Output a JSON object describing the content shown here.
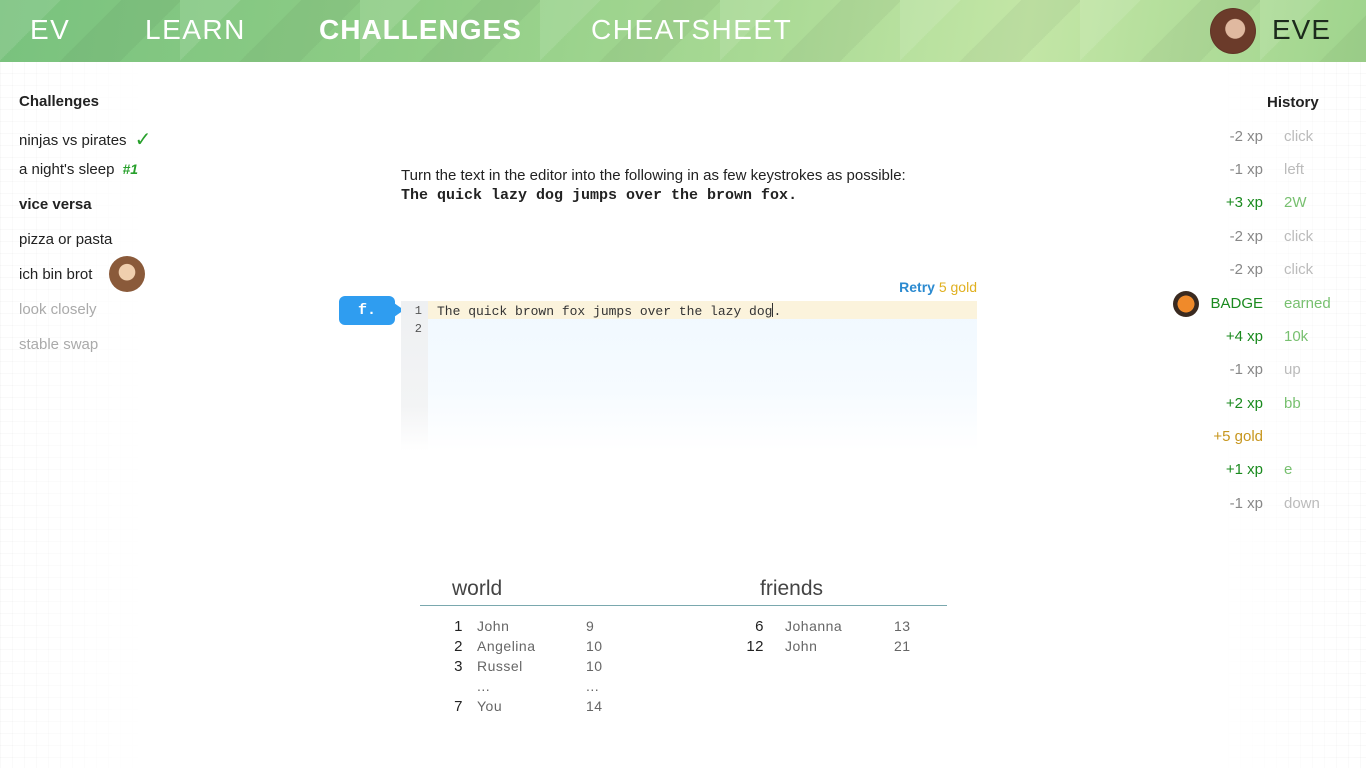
{
  "nav": {
    "logo": "EV",
    "learn": "LEARN",
    "challenges": "CHALLENGES",
    "cheatsheet": "CHEATSHEET",
    "user_name": "EVE"
  },
  "sidebar": {
    "title": "Challenges",
    "items": [
      {
        "label": "ninjas vs pirates",
        "status": "completed"
      },
      {
        "label": "a night's sleep",
        "tag": "#1"
      },
      {
        "label": "vice versa",
        "status": "current"
      },
      {
        "label": "pizza or pasta"
      },
      {
        "label": "ich bin brot",
        "status": "friend"
      },
      {
        "label": "look closely",
        "status": "locked"
      },
      {
        "label": "stable swap",
        "status": "locked"
      }
    ]
  },
  "task": {
    "instruction": "Turn the text in the editor into the following in as few keystrokes as possible:",
    "target": "The quick lazy dog jumps over the brown fox."
  },
  "editor": {
    "retry_label": "Retry",
    "retry_cost": "5 gold",
    "hint": "f.",
    "lines": [
      {
        "num": "1",
        "text_before_cursor": "The quick brown fox jumps over the lazy dog",
        "text_after_cursor": "."
      },
      {
        "num": "2",
        "text": ""
      }
    ]
  },
  "leaderboard": {
    "world_title": "world",
    "friends_title": "friends",
    "world": [
      {
        "rank": "1",
        "name": "John",
        "score": "9"
      },
      {
        "rank": "2",
        "name": "Angelina",
        "score": "10"
      },
      {
        "rank": "3",
        "name": "Russel",
        "score": "10"
      },
      {
        "rank": "",
        "name": "...",
        "score": "..."
      },
      {
        "rank": "7",
        "name": "You",
        "score": "14"
      }
    ],
    "friends": [
      {
        "rank": "6",
        "name": "Johanna",
        "score": "13"
      },
      {
        "rank": "12",
        "name": "John",
        "score": "21"
      }
    ]
  },
  "history": {
    "title": "History",
    "entries": [
      {
        "value": "-2 xp",
        "key": "click",
        "kind": "neg"
      },
      {
        "value": "-1 xp",
        "key": "left",
        "kind": "neg"
      },
      {
        "value": "+3 xp",
        "key": "2W",
        "kind": "pos"
      },
      {
        "value": "-2 xp",
        "key": "click",
        "kind": "neg"
      },
      {
        "value": "-2 xp",
        "key": "click",
        "kind": "neg"
      },
      {
        "value": "BADGE",
        "key": "earned",
        "kind": "pos"
      },
      {
        "value": "+4 xp",
        "key": "10k",
        "kind": "pos"
      },
      {
        "value": "-1 xp",
        "key": "up",
        "kind": "neg"
      },
      {
        "value": "+2 xp",
        "key": "bb",
        "kind": "pos"
      },
      {
        "value": "+5 gold",
        "key": "",
        "kind": "gold"
      },
      {
        "value": "+1 xp",
        "key": "e",
        "kind": "pos"
      },
      {
        "value": "-1 xp",
        "key": "down",
        "kind": "neg"
      }
    ]
  }
}
